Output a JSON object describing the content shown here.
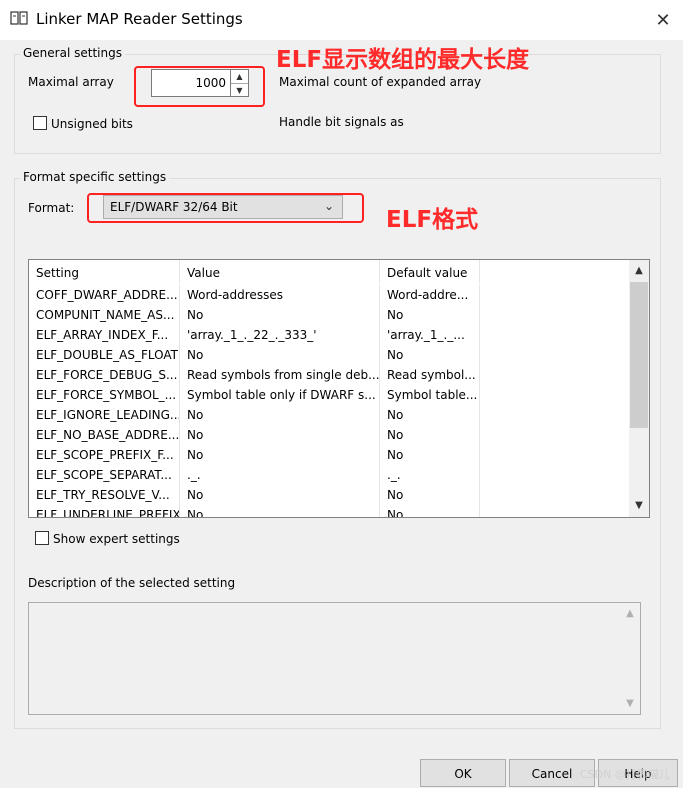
{
  "window": {
    "title": "Linker MAP Reader Settings"
  },
  "general": {
    "group_label": "General settings",
    "maximal_array_label": "Maximal array",
    "maximal_array_value": "1000",
    "maximal_array_desc": "Maximal count of expanded array",
    "unsigned_bits_label": "Unsigned bits",
    "handle_bit_signals_label": "Handle bit signals as"
  },
  "annotations": {
    "elf_array": "ELF显示数组的最大长度",
    "elf_format": "ELF格式",
    "color": "#ff2020"
  },
  "format": {
    "group_label": "Format specific settings",
    "format_label": "Format:",
    "selected": "ELF/DWARF 32/64 Bit"
  },
  "table": {
    "headers": [
      "Setting",
      "Value",
      "Default value"
    ],
    "rows": [
      [
        "COFF_DWARF_ADDRE...",
        "Word-addresses",
        "Word-addre..."
      ],
      [
        "COMPUNIT_NAME_AS...",
        "No",
        "No"
      ],
      [
        "ELF_ARRAY_INDEX_F...",
        "'array._1_._22_._333_'",
        "'array._1_._..."
      ],
      [
        "ELF_DOUBLE_AS_FLOAT",
        "No",
        "No"
      ],
      [
        "ELF_FORCE_DEBUG_S...",
        "Read symbols from single deb...",
        "Read symbol..."
      ],
      [
        "ELF_FORCE_SYMBOL_...",
        "Symbol table only if DWARF s...",
        "Symbol table..."
      ],
      [
        "ELF_IGNORE_LEADING...",
        "No",
        "No"
      ],
      [
        "ELF_NO_BASE_ADDRE...",
        "No",
        "No"
      ],
      [
        "ELF_SCOPE_PREFIX_F...",
        "No",
        "No"
      ],
      [
        "ELF_SCOPE_SEPARAT...",
        "._.",
        "._."
      ],
      [
        "ELF_TRY_RESOLVE_V...",
        "No",
        "No"
      ],
      [
        "ELF_UNDERLINE_PREFIX",
        "No",
        "No"
      ]
    ]
  },
  "expert": {
    "label": "Show expert settings"
  },
  "description": {
    "label": "Description of the selected setting"
  },
  "buttons": {
    "ok": "OK",
    "cancel": "Cancel",
    "help": "Help"
  },
  "watermark": "CSDN @打脚喵儿"
}
